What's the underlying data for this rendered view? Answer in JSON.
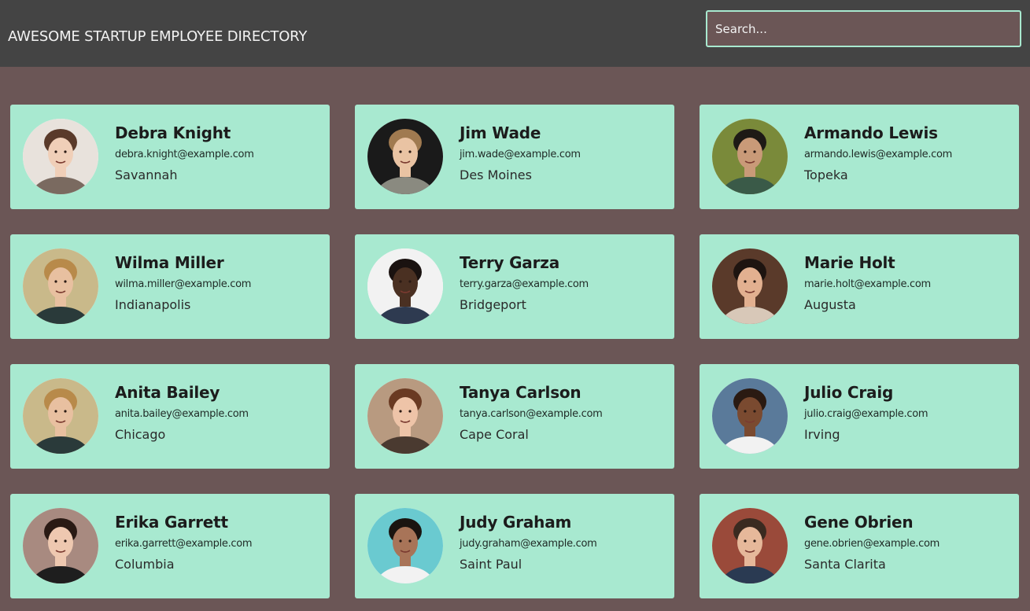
{
  "header": {
    "title": "AWESOME STARTUP EMPLOYEE DIRECTORY",
    "search_placeholder": "Search..."
  },
  "colors": {
    "header_bg": "#444444",
    "page_bg": "#6b5656",
    "card_bg": "#a8e9d0",
    "search_border": "#a8e9d0"
  },
  "employees": [
    {
      "name": "Debra Knight",
      "email": "debra.knight@example.com",
      "city": "Savannah",
      "avatar": {
        "bg": "#e8e2dc",
        "skin": "#f0cfb8",
        "hair": "#5a3a2a",
        "shirt": "#7a6a60"
      }
    },
    {
      "name": "Jim Wade",
      "email": "jim.wade@example.com",
      "city": "Des Moines",
      "avatar": {
        "bg": "#1a1a1a",
        "skin": "#e9c3a3",
        "hair": "#a07a50",
        "shirt": "#8a8a80"
      }
    },
    {
      "name": "Armando Lewis",
      "email": "armando.lewis@example.com",
      "city": "Topeka",
      "avatar": {
        "bg": "#7a8a3a",
        "skin": "#c99a78",
        "hair": "#1e1a16",
        "shirt": "#3a5a48"
      }
    },
    {
      "name": "Wilma Miller",
      "email": "wilma.miller@example.com",
      "city": "Indianapolis",
      "avatar": {
        "bg": "#c9b98a",
        "skin": "#e8c0a0",
        "hair": "#b88a4a",
        "shirt": "#2a3a3a"
      }
    },
    {
      "name": "Terry Garza",
      "email": "terry.garza@example.com",
      "city": "Bridgeport",
      "avatar": {
        "bg": "#f2f2f2",
        "skin": "#4a3022",
        "hair": "#1a1210",
        "shirt": "#2e3a50"
      }
    },
    {
      "name": "Marie Holt",
      "email": "marie.holt@example.com",
      "city": "Augusta",
      "avatar": {
        "bg": "#5a3a2a",
        "skin": "#e2b090",
        "hair": "#1e1410",
        "shirt": "#d8c8b8"
      }
    },
    {
      "name": "Anita Bailey",
      "email": "anita.bailey@example.com",
      "city": "Chicago",
      "avatar": {
        "bg": "#c9b98a",
        "skin": "#e8c0a0",
        "hair": "#b88a4a",
        "shirt": "#2a3a3a"
      }
    },
    {
      "name": "Tanya Carlson",
      "email": "tanya.carlson@example.com",
      "city": "Cape Coral",
      "avatar": {
        "bg": "#b89a80",
        "skin": "#eec4a8",
        "hair": "#6a3a22",
        "shirt": "#4a3a30"
      }
    },
    {
      "name": "Julio Craig",
      "email": "julio.craig@example.com",
      "city": "Irving",
      "avatar": {
        "bg": "#5a7a9a",
        "skin": "#7a4a30",
        "hair": "#2a1a12",
        "shirt": "#f2f2f2"
      }
    },
    {
      "name": "Erika Garrett",
      "email": "erika.garrett@example.com",
      "city": "Columbia",
      "avatar": {
        "bg": "#a88a80",
        "skin": "#eec8b0",
        "hair": "#2a1a14",
        "shirt": "#1e1e1e"
      }
    },
    {
      "name": "Judy Graham",
      "email": "judy.graham@example.com",
      "city": "Saint Paul",
      "avatar": {
        "bg": "#6acad0",
        "skin": "#a87458",
        "hair": "#1a1410",
        "shirt": "#f2f2f2"
      }
    },
    {
      "name": "Gene Obrien",
      "email": "gene.obrien@example.com",
      "city": "Santa Clarita",
      "avatar": {
        "bg": "#9a4a3a",
        "skin": "#e6b89a",
        "hair": "#3a2a20",
        "shirt": "#2a3a52"
      }
    }
  ]
}
